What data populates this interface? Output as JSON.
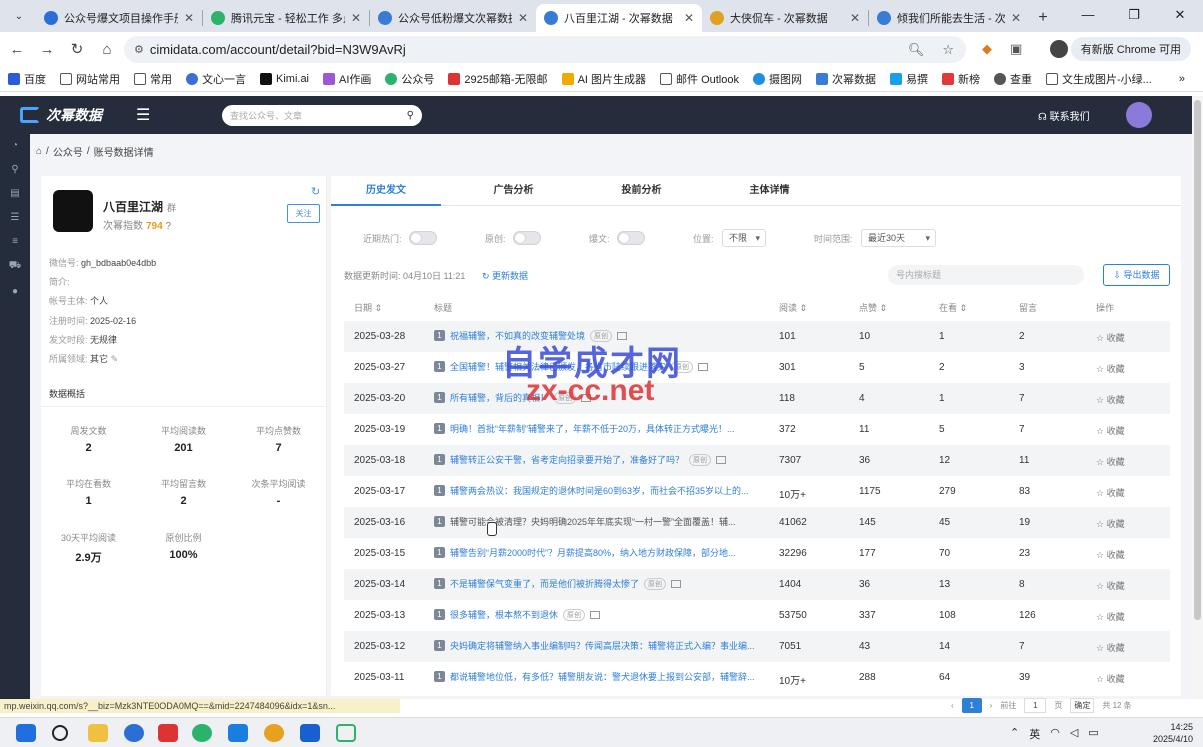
{
  "browser": {
    "tabs": [
      {
        "title": "公众号爆文项目操作手册",
        "color": "#2b6fd6",
        "active": false
      },
      {
        "title": "腾讯元宝 - 轻松工作 多点生活",
        "color": "#2bb36b",
        "active": false
      },
      {
        "title": "公众号低粉爆文次幂数据",
        "color": "#3a7bd5",
        "active": false
      },
      {
        "title": "八百里江湖 - 次幂数据",
        "color": "#3a7bd5",
        "active": true
      },
      {
        "title": "大侠侃车 - 次幂数据",
        "color": "#e0a020",
        "active": false
      },
      {
        "title": "倾我们所能去生活 - 次幂数据",
        "color": "#3a7bd5",
        "active": false
      }
    ],
    "url": "cimidata.com/account/detail?bid=N3W9AvRj",
    "update_label": "有新版 Chrome 可用",
    "bookmarks": [
      "百度",
      "网站常用",
      "常用",
      "文心一言",
      "Kimi.ai",
      "AI作画",
      "公众号",
      "2925邮箱-无限邮",
      "AI 图片生成器",
      "邮件 Outlook",
      "摄图网",
      "次幂数据",
      "易撰",
      "新榜",
      "查重",
      "文生成图片-小绿..."
    ]
  },
  "site": {
    "logo": "次幂数据",
    "search_placeholder": "查找公众号、文章",
    "contact": "联系我们"
  },
  "breadcrumb": {
    "home": "⌂",
    "level1": "公众号",
    "level2": "账号数据详情"
  },
  "profile": {
    "name": "八百里江湖",
    "badge": "群",
    "score_label": "次幂指数",
    "score": "794",
    "follow": "关注",
    "wechat_id_label": "微信号:",
    "wechat_id": "gh_bdbaab0e4dbb",
    "intro_label": "简介:",
    "intro": "",
    "owner_label": "帐号主体:",
    "owner": "个人",
    "reg_label": "注册时间:",
    "reg": "2025-02-16",
    "post_label": "发文时段:",
    "post": "无规律",
    "field_label": "所属领域:",
    "field": "其它",
    "summary_title": "数据概括",
    "stats": [
      {
        "label": "周发文数",
        "value": "2"
      },
      {
        "label": "平均阅读数",
        "value": "201"
      },
      {
        "label": "平均点赞数",
        "value": "7"
      },
      {
        "label": "平均在看数",
        "value": "1"
      },
      {
        "label": "平均留言数",
        "value": "2"
      },
      {
        "label": "次条平均阅读",
        "value": "-"
      },
      {
        "label": "30天平均阅读",
        "value": "2.9万"
      },
      {
        "label": "原创比例",
        "value": "100%"
      }
    ]
  },
  "main": {
    "tabs": [
      "历史发文",
      "广告分析",
      "投前分析",
      "主体详情"
    ],
    "filters": {
      "hot": "近期热门:",
      "original": "原创:",
      "viral": "爆文:",
      "position": "位置:",
      "position_value": "不限",
      "range": "时间范围:",
      "range_value": "最近30天"
    },
    "update_time": "数据更新时间: 04月10日 11:21",
    "update_btn": "更新数据",
    "kw_placeholder": "号内搜标题",
    "export": "导出数据",
    "headers": [
      "日期",
      "标题",
      "阅读",
      "点赞",
      "在看",
      "留言",
      "操作"
    ],
    "fav_label": "收藏",
    "rows": [
      {
        "date": "2025-03-28",
        "title": "祝福辅警，不如真的改变辅警处境",
        "read": "101",
        "like": "10",
        "watch": "1",
        "comment": "2",
        "original": true
      },
      {
        "date": "2025-03-27",
        "title": "全国辅警！辅警相关法律已颁发，各省市陆续跟进落实",
        "read": "301",
        "like": "5",
        "watch": "2",
        "comment": "3",
        "original": true
      },
      {
        "date": "2025-03-20",
        "title": "所有辅警，背后的真相！",
        "read": "118",
        "like": "4",
        "watch": "1",
        "comment": "7",
        "original": true
      },
      {
        "date": "2025-03-19",
        "title": "明确！首批“年薪制”辅警来了，年薪不低于20万，具体转正方式曝光！...",
        "read": "372",
        "like": "11",
        "watch": "5",
        "comment": "7",
        "original": false
      },
      {
        "date": "2025-03-18",
        "title": "辅警转正公安干警，省考定向招录要开始了，准备好了吗？",
        "read": "7307",
        "like": "36",
        "watch": "12",
        "comment": "11",
        "original": true
      },
      {
        "date": "2025-03-17",
        "title": "辅警两会热议：我国规定的退休时间是60到63岁，而社会不招35岁以上的...",
        "read": "10万+",
        "like": "1175",
        "watch": "279",
        "comment": "83",
        "original": false
      },
      {
        "date": "2025-03-16",
        "title": "辅警可能会被清理？央妈明确2025年年底实现“一村一警”全面覆盖！辅...",
        "read": "41062",
        "like": "145",
        "watch": "45",
        "comment": "19",
        "original": false
      },
      {
        "date": "2025-03-15",
        "title": "辅警告别“月薪2000时代”？月薪提高80%，纳入地方财政保障，部分地...",
        "read": "32296",
        "like": "177",
        "watch": "70",
        "comment": "23",
        "original": false
      },
      {
        "date": "2025-03-14",
        "title": "不是辅警保气变重了，而是他们被折腾得太惨了",
        "read": "1404",
        "like": "36",
        "watch": "13",
        "comment": "8",
        "original": true
      },
      {
        "date": "2025-03-13",
        "title": "很多辅警，根本熬不到退休",
        "read": "53750",
        "like": "337",
        "watch": "108",
        "comment": "126",
        "original": true
      },
      {
        "date": "2025-03-12",
        "title": "央妈确定将辅警纳入事业编制吗？传闻高层决策：辅警将正式入编？事业编...",
        "read": "7051",
        "like": "43",
        "watch": "14",
        "comment": "7",
        "original": false
      },
      {
        "date": "2025-03-11",
        "title": "都说辅警地位低，有多低？辅警朋友说：警犬退休要上报到公安部，辅警辞...",
        "read": "10万+",
        "like": "288",
        "watch": "64",
        "comment": "39",
        "original": false
      }
    ],
    "original_tag": "原创",
    "pager": {
      "page": "1",
      "goto": "前往",
      "goto_value": "1",
      "page_unit": "页",
      "confirm": "确定",
      "total": "共 12 条"
    }
  },
  "status_url": "mp.weixin.qq.com/s?__biz=Mzk3NTE0ODA0MQ==&mid=2247484096&idx=1&sn...",
  "watermark": {
    "line1": "自学成才网",
    "line2": "zx-cc.net"
  },
  "taskbar": {
    "time": "14:25",
    "date": "2025/4/10",
    "ime": "英"
  }
}
